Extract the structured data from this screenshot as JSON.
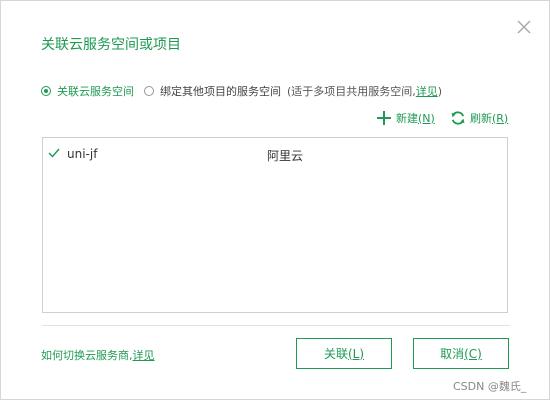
{
  "dialog": {
    "title": "关联云服务空间或项目"
  },
  "options": {
    "selected_label": "关联云服务空间",
    "other_label": "绑定其他项目的服务空间",
    "hint": "(适于多项目共用服务空间,",
    "hint_link": "详见",
    "hint_end": ")"
  },
  "toolbar": {
    "new_label": "新建",
    "new_shortcut": "(N)",
    "refresh_label": "刷新",
    "refresh_shortcut": "(R)"
  },
  "spaces": [
    {
      "name": "uni-jf",
      "provider": "阿里云",
      "checked": true
    }
  ],
  "footer": {
    "text": "如何切换云服务商,",
    "link": "详见"
  },
  "buttons": {
    "ok_label": "关联",
    "ok_shortcut": "(L)",
    "cancel_label": "取消",
    "cancel_shortcut": "(C)"
  },
  "watermark": "CSDN @魏氏_",
  "colors": {
    "accent": "#1e9a54",
    "border": "#cfcfcf",
    "text": "#333333"
  },
  "icons": {
    "close": "close-icon",
    "new": "plus-icon",
    "refresh": "refresh-icon",
    "check": "check-icon"
  }
}
